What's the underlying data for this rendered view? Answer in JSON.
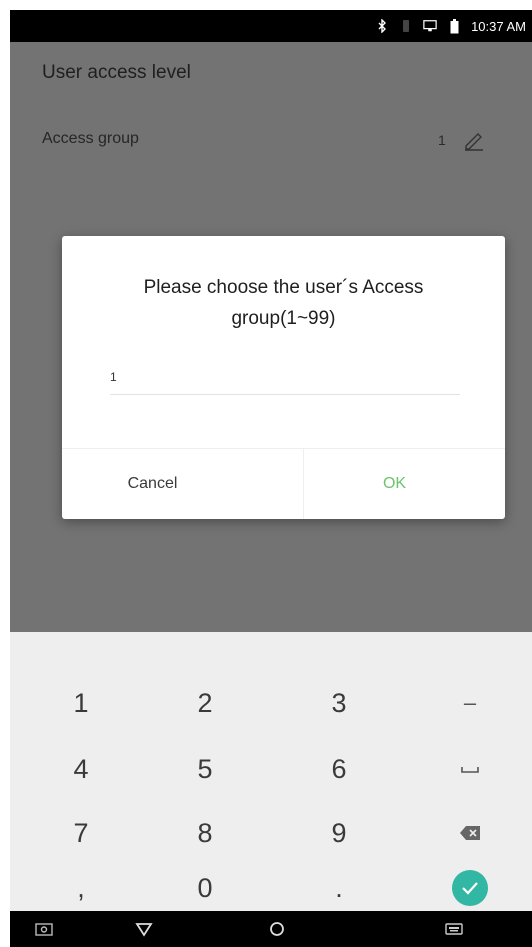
{
  "status_bar": {
    "time": "10:37 AM",
    "icons": [
      "bluetooth-icon",
      "signal-icon",
      "cast-icon",
      "battery-icon"
    ]
  },
  "page": {
    "section_title": "User access level",
    "access_group_label": "Access group",
    "access_group_value": "1"
  },
  "dialog": {
    "message": "Please choose the user´s Access group(1~99)",
    "input_value": "1",
    "cancel_label": "Cancel",
    "ok_label": "OK",
    "ok_color": "#6cc46a"
  },
  "keypad": {
    "keys": [
      "1",
      "2",
      "3",
      "–",
      "4",
      "5",
      "6",
      "⎵",
      "7",
      "8",
      "9",
      "⌫",
      ",",
      "0",
      ".",
      "✓"
    ],
    "done_color": "#31b7a3"
  },
  "nav_bar": {
    "icons": [
      "screenshot-icon",
      "back-icon",
      "home-icon",
      "keyboard-icon"
    ]
  }
}
